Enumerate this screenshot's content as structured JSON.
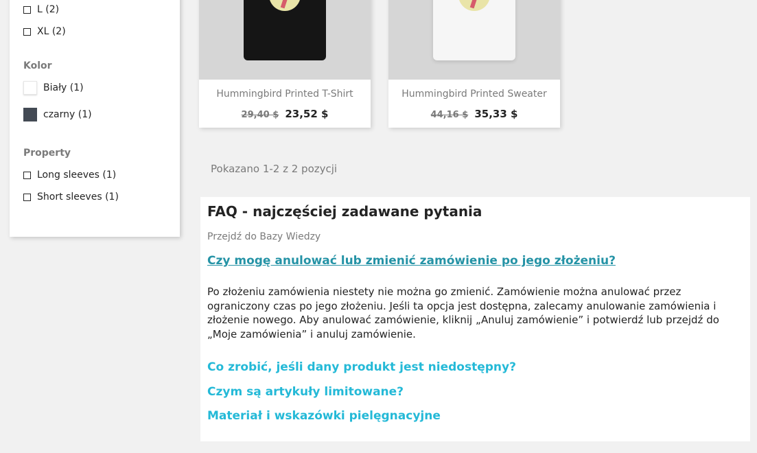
{
  "sidebar": {
    "sizes": [
      {
        "label": "L (2)"
      },
      {
        "label": "XL (2)"
      }
    ],
    "color_title": "Kolor",
    "colors": [
      {
        "label": "Biały (1)",
        "swatch": "#ffffff"
      },
      {
        "label": "czarny (1)",
        "swatch": "#434a54"
      }
    ],
    "property_title": "Property",
    "properties": [
      {
        "label": "Long sleeves (1)"
      },
      {
        "label": "Short sleeves (1)"
      }
    ]
  },
  "products": [
    {
      "name": "Hummingbird Printed T-Shirt",
      "old_price": "29,40 $",
      "price": "23,52 $"
    },
    {
      "name": "Hummingbird Printed Sweater",
      "old_price": "44,16 $",
      "price": "35,33 $"
    }
  ],
  "pagination": {
    "summary": "Pokazano 1-2 z 2 pozycji"
  },
  "faq": {
    "title": "FAQ - najczęściej zadawane pytania",
    "kb_link": "Przejdź do Bazy Wiedzy",
    "active_question": "Czy mogę anulować lub zmienić zamówienie po jego złożeniu?",
    "active_answer": "Po złożeniu zamówienia niestety nie można go zmienić. Zamówienie można anulować przez ograniczony czas po jego złożeniu. Jeśli ta opcja jest dostępna, zalecamy anulowanie zamówienia i złożenie nowego. Aby anulować zamówienie, kliknij „Anuluj zamówienie” i potwierdź lub przejdź do „Moje zamówienia” i anuluj zamówienie.",
    "questions": [
      {
        "label": "Co zrobić, jeśli dany produkt jest niedostępny?"
      },
      {
        "label": "Czym są artykuły limitowane?"
      },
      {
        "label": "Materiał i wskazówki pielęgnacyjne"
      }
    ]
  },
  "colors": {
    "link": "#24b9d7",
    "link_active": "#2593a6",
    "text": "#232323",
    "muted": "#7a7a7a"
  }
}
